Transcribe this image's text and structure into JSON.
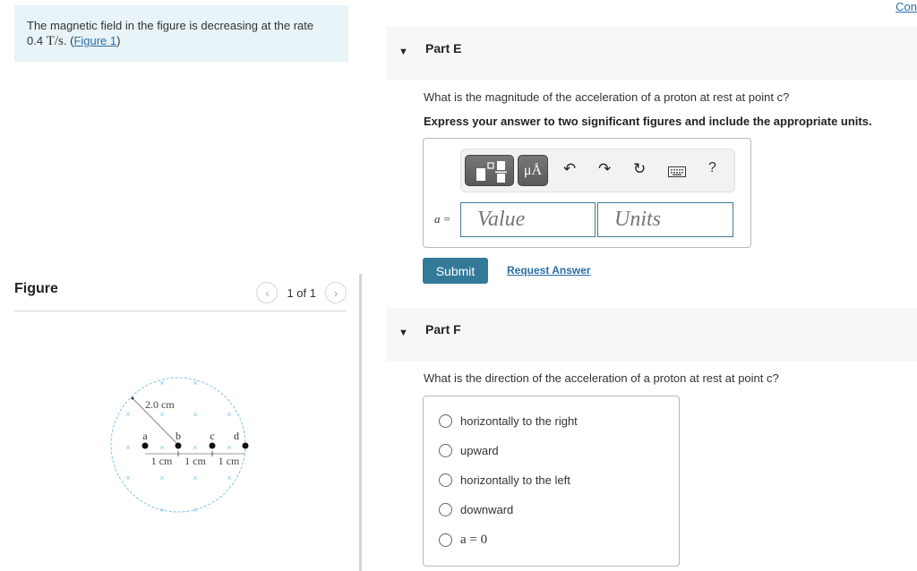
{
  "intro": {
    "text": "The magnetic field in the figure is decreasing at the rate",
    "rate_value": "0.4",
    "rate_units": "T/s",
    "sep": ". (",
    "figure_link": "Figure 1",
    "close": ")"
  },
  "figure_panel": {
    "title": "Figure",
    "pager_text": "1 of 1",
    "prev_icon": "chevron-left-icon",
    "next_icon": "chevron-right-icon",
    "diagram": {
      "radius_label": "2.0 cm",
      "points": [
        "a",
        "b",
        "c",
        "d"
      ],
      "spacing_labels": [
        "1 cm",
        "1 cm",
        "1 cm"
      ],
      "field_symbol": "×",
      "field_color": "#7fc4e8"
    }
  },
  "top_link": "Con",
  "part_e": {
    "title": "Part E",
    "question": "What is the magnitude of the acceleration of a proton at rest at point c?",
    "instruction": "Express your answer to two significant figures and include the appropriate units.",
    "toolbar": {
      "templates_icon": "fraction-template-icon",
      "units_label": "μÅ",
      "undo_icon": "undo-icon",
      "redo_icon": "redo-icon",
      "reset_icon": "reset-icon",
      "keyboard_icon": "keyboard-icon",
      "help_label": "?"
    },
    "answer_label": "a =",
    "value_placeholder": "Value",
    "units_placeholder": "Units",
    "submit_label": "Submit",
    "request_label": "Request Answer"
  },
  "part_f": {
    "title": "Part F",
    "question": "What is the direction of the acceleration of a proton at rest at point c?",
    "options": [
      "horizontally to the right",
      "upward",
      "horizontally to the left",
      "downward",
      "a = 0"
    ]
  },
  "colors": {
    "accent": "#337a99",
    "link": "#2a6ea8",
    "intro_bg": "#e8f4f7"
  }
}
